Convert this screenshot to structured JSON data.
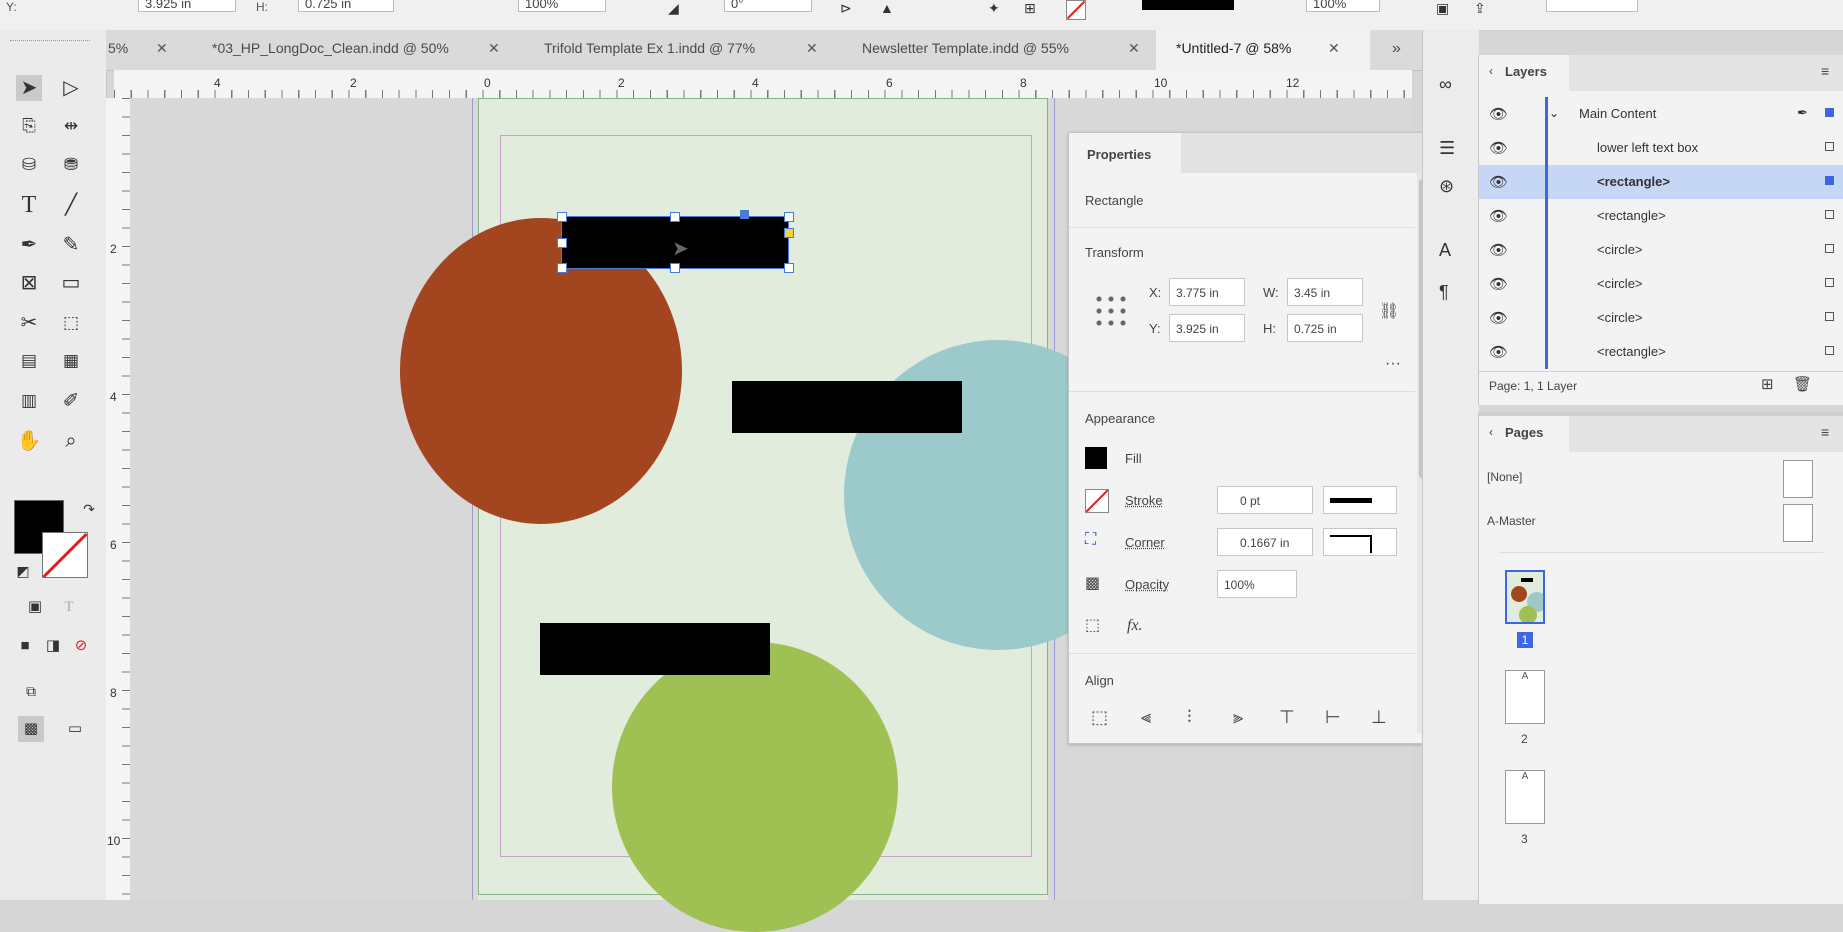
{
  "control_bar": {
    "y_label": "Y:",
    "y_value": "3.925 in",
    "h_label": "H:",
    "h_value": "0.725 in",
    "scale_value": "100%",
    "rotate_value": "0°",
    "opacity_value": "100%"
  },
  "tabs": [
    {
      "label": "5%",
      "close": "✕"
    },
    {
      "label": "*03_HP_LongDoc_Clean.indd @ 50%",
      "close": "✕"
    },
    {
      "label": "Trifold Template Ex 1.indd @ 77%",
      "close": "✕"
    },
    {
      "label": "Newsletter Template.indd @ 55%",
      "close": "✕"
    },
    {
      "label": "*Untitled-7 @ 58%",
      "close": "✕"
    }
  ],
  "tab_overflow": "»",
  "ruler": {
    "h_ticks": [
      "4",
      "2",
      "0",
      "2",
      "4",
      "6",
      "8",
      "10",
      "12"
    ],
    "v_ticks": [
      "2",
      "4",
      "6",
      "8",
      "10"
    ]
  },
  "properties": {
    "tab": "Properties",
    "object_type": "Rectangle",
    "transform_heading": "Transform",
    "x_label": "X:",
    "x_value": "3.775 in",
    "w_label": "W:",
    "w_value": "3.45 in",
    "y_label": "Y:",
    "y_value": "3.925 in",
    "h_label": "H:",
    "h_value": "0.725 in",
    "more": "···",
    "appearance_heading": "Appearance",
    "fill_label": "Fill",
    "stroke_label": "Stroke",
    "stroke_value": "0 pt",
    "corner_label": "Corner",
    "corner_value": "0.1667 in",
    "opacity_label": "Opacity",
    "opacity_value": "100%",
    "fx_label": "fx.",
    "align_heading": "Align"
  },
  "layers": {
    "title": "Layers",
    "group": "Main Content",
    "items": [
      {
        "name": "lower left text box",
        "selected": false
      },
      {
        "name": "<rectangle>",
        "selected": true
      },
      {
        "name": "<rectangle>",
        "selected": false
      },
      {
        "name": "<circle>",
        "selected": false
      },
      {
        "name": "<circle>",
        "selected": false
      },
      {
        "name": "<circle>",
        "selected": false
      },
      {
        "name": "<rectangle>",
        "selected": false
      }
    ],
    "footer": "Page: 1, 1 Layer"
  },
  "pages": {
    "title": "Pages",
    "none_label": "[None]",
    "master_label": "A-Master",
    "page_numbers": [
      "1",
      "2",
      "3"
    ],
    "master_letter": "A"
  },
  "colors": {
    "rust_circle": "#a3451f",
    "teal_circle": "#9ccacb",
    "green_circle": "#9fc053",
    "page": "#e2ecdd",
    "selection": "#4a7bd9"
  }
}
